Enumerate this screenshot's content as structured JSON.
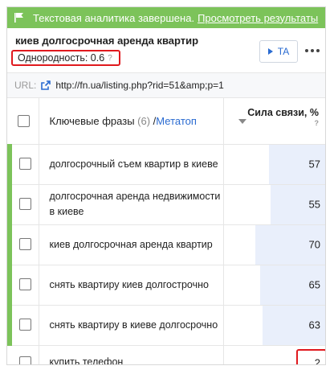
{
  "banner": {
    "message": "Текстовая аналитика завершена.",
    "link": "Просмотреть результаты"
  },
  "header": {
    "title": "киев долгосрочная аренда квартир",
    "uniformity": "Однородность: 0.6",
    "help_mark": "?",
    "ta_button": "TA"
  },
  "url": {
    "label": "URL:",
    "value": "http://fn.ua/listing.php?rid=51&amp;p=1"
  },
  "table": {
    "col_phrases": "Ключевые фразы",
    "count": "(6)",
    "separator": "/",
    "meta": "Метатоп",
    "col_strength": "Сила связи, %",
    "help_mark": "?",
    "rows": [
      {
        "phrase": "долгосрочный съем квартир в киеве",
        "value": "57",
        "fraction": 0.57
      },
      {
        "phrase": "долгосрочная аренда недвижимости в киеве",
        "value": "55",
        "fraction": 0.55
      },
      {
        "phrase": "киев долгосрочная аренда квартир",
        "value": "70",
        "fraction": 0.7
      },
      {
        "phrase": "снять квартиру киев долгострочно",
        "value": "65",
        "fraction": 0.65
      },
      {
        "phrase": "снять квартиру в киеве долгосрочно",
        "value": "63",
        "fraction": 0.63
      },
      {
        "phrase": "купить телефон",
        "value": "2",
        "fraction": 0.02
      }
    ]
  },
  "colors": {
    "accent_green": "#7cc35a",
    "highlight_red": "#e0191e",
    "link_blue": "#2a6bd1",
    "bar_fill": "#e9effb"
  }
}
